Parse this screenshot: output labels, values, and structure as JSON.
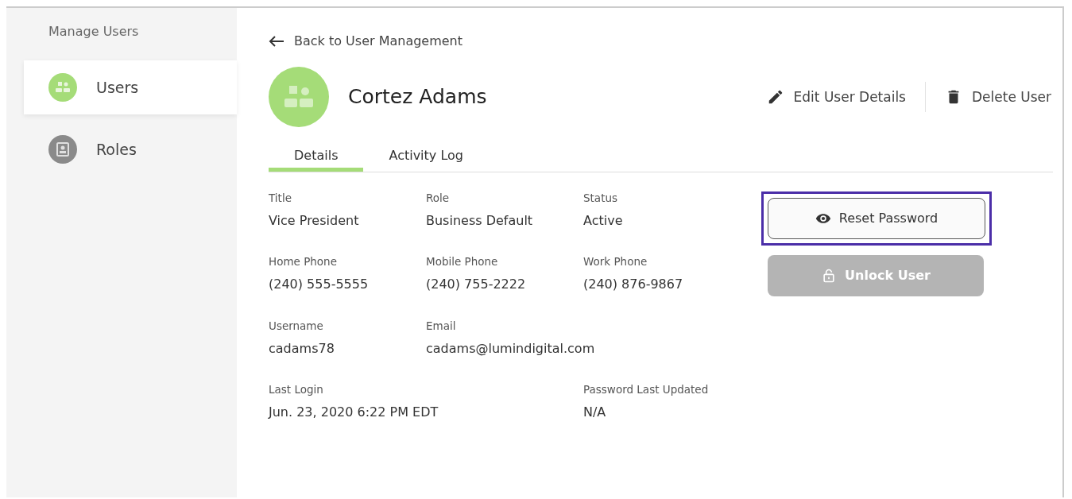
{
  "sidebar": {
    "title": "Manage Users",
    "items": [
      {
        "label": "Users",
        "kind": "users",
        "selected": true
      },
      {
        "label": "Roles",
        "kind": "roles",
        "selected": false
      }
    ]
  },
  "back_link": "Back to User Management",
  "user": {
    "name": "Cortez Adams"
  },
  "actions": [
    {
      "label": "Edit User Details",
      "kind": "edit"
    },
    {
      "label": "Delete User",
      "kind": "delete"
    }
  ],
  "tabs": [
    {
      "label": "Details",
      "selected": true
    },
    {
      "label": "Activity Log",
      "selected": false
    }
  ],
  "field_rows": [
    {
      "column_1": {
        "label": "Title",
        "value": "Vice President"
      },
      "column_2": {
        "label": "Role",
        "value": "Business Default"
      },
      "column_3": {
        "label": "Status",
        "value": "Active"
      }
    },
    {
      "column_1": {
        "label": "Home Phone",
        "value": "(240) 555-5555"
      },
      "column_2": {
        "label": "Mobile Phone",
        "value": "(240) 755-2222"
      },
      "column_3": {
        "label": "Work Phone",
        "value": "(240) 876-9867"
      }
    },
    {
      "column_1": {
        "label": "Username",
        "value": "cadams78"
      },
      "column_2": {
        "label": "Email",
        "value": "cadams@lumindigital.com"
      }
    },
    {
      "column_1": {
        "label": "Last Login",
        "value": "Jun. 23, 2020 6:22 PM EDT"
      },
      "column_3": {
        "label": "Password Last Updated",
        "value": "N/A"
      }
    }
  ],
  "buttons": [
    {
      "label": "Reset Password",
      "kind": "eye",
      "focused": true,
      "disabled": false
    },
    {
      "label": "Unlock User",
      "kind": "lock",
      "focused": false,
      "disabled": true
    }
  ]
}
